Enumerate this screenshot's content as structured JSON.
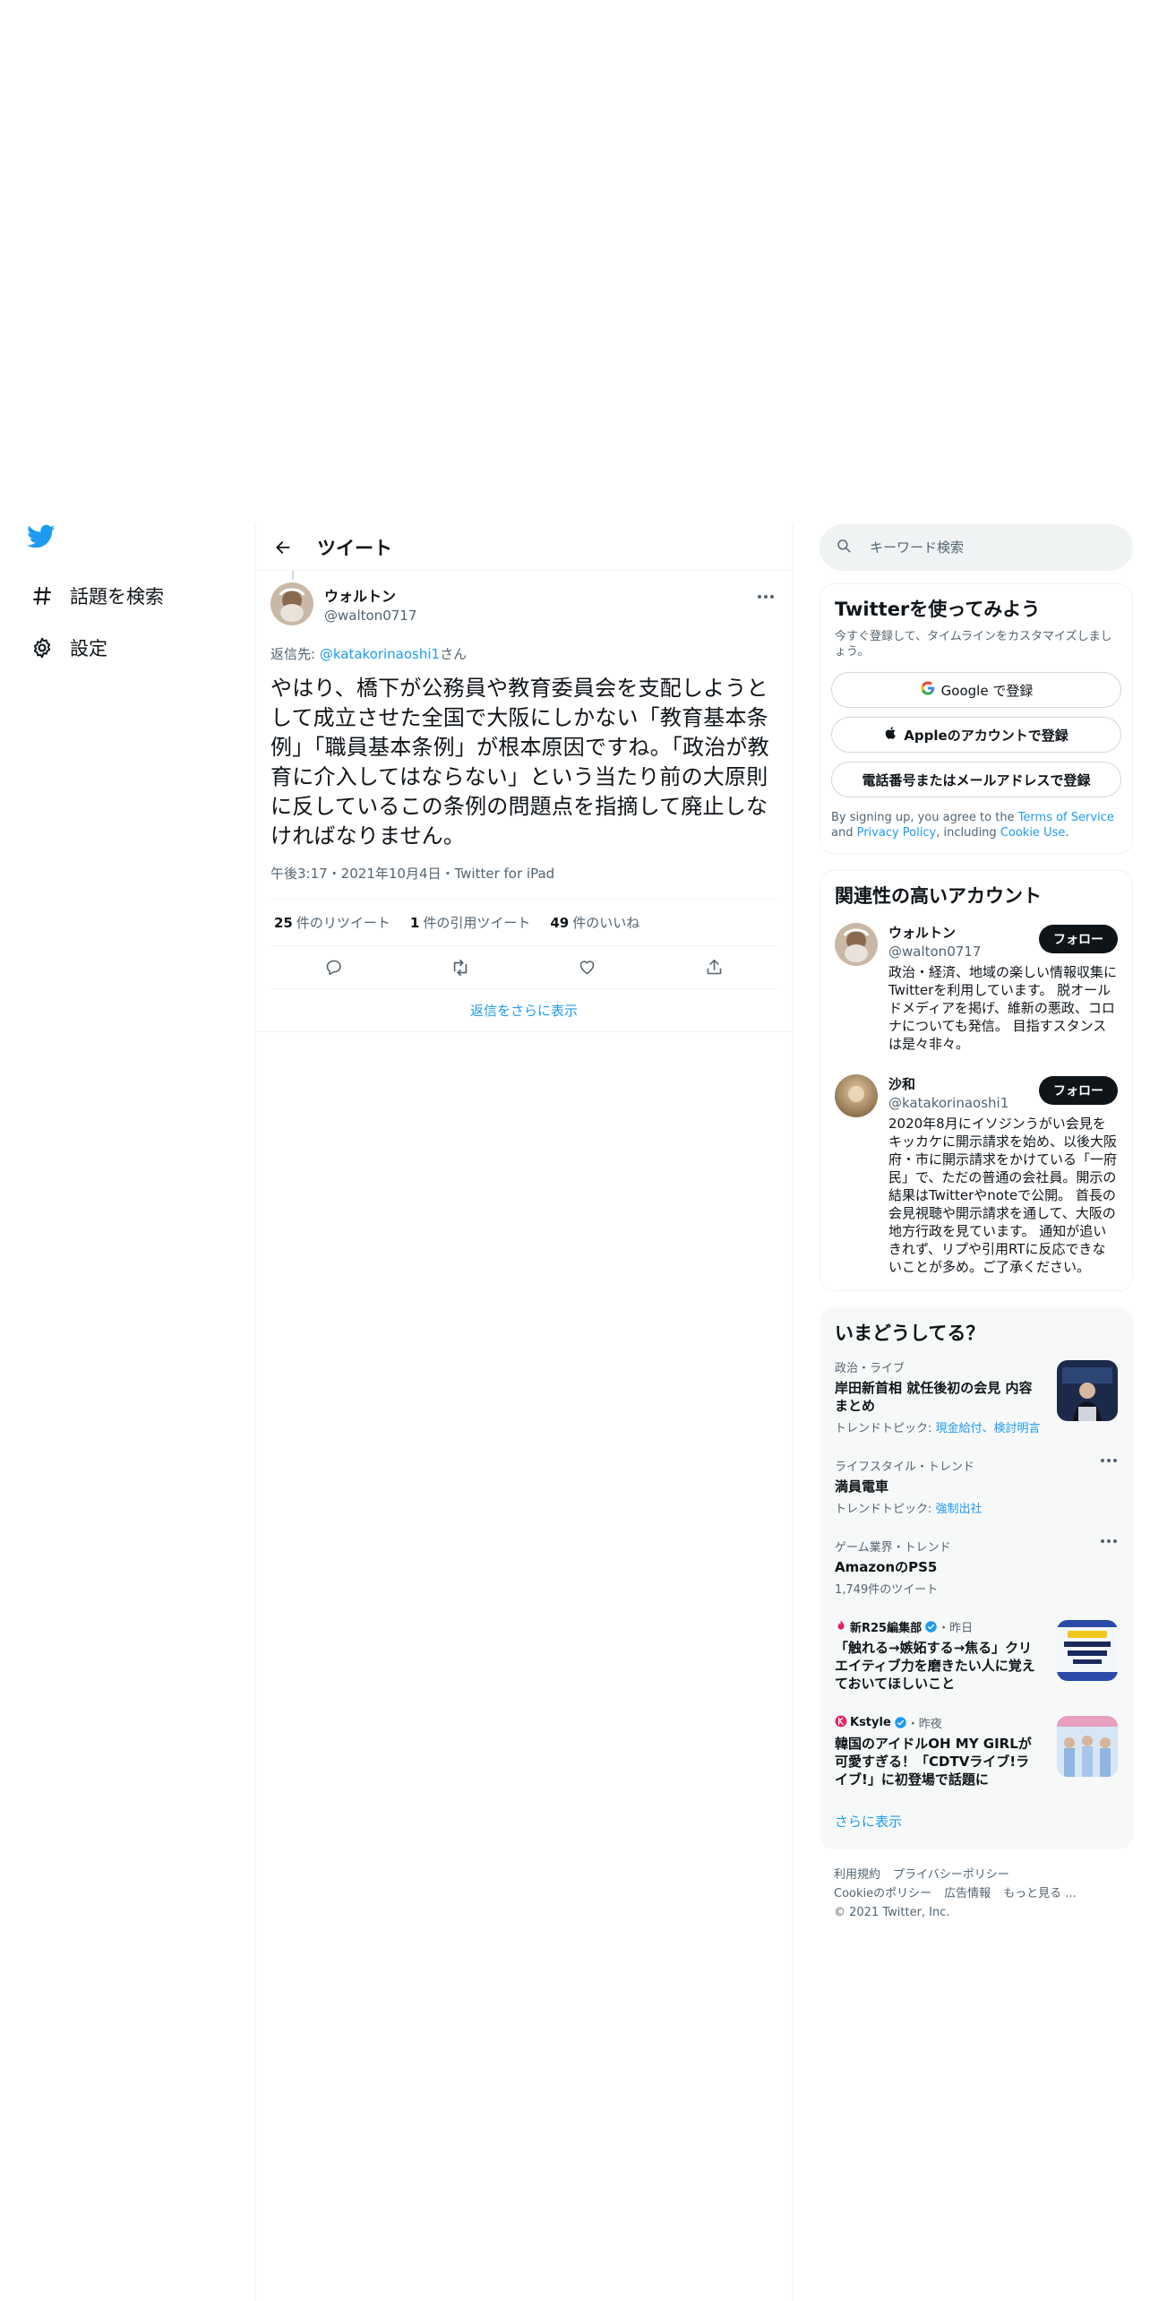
{
  "nav": {
    "items": [
      {
        "label": "話題を検索",
        "icon": "hashtag-icon"
      },
      {
        "label": "設定",
        "icon": "gear-icon"
      }
    ]
  },
  "header": {
    "title": "ツイート"
  },
  "tweet": {
    "author_name": "ウォルトン",
    "author_handle": "@walton0717",
    "reply_prefix": "返信先: ",
    "reply_handle": "@katakorinaoshi1",
    "reply_suffix": "さん",
    "text": "やはり、橋下が公務員や教育委員会を支配しようとして成立させた全国で大阪にしかない「教育基本条例」「職員基本条例」が根本原因ですね。「政治が教育に介入してはならない」という当たり前の大原則に反しているこの条例の問題点を指摘して廃止しなければなりません。",
    "meta": "午後3:17・2021年10月4日・Twitter for iPad",
    "retweets_count": "25",
    "retweets_label": "件のリツイート",
    "quotes_count": "1",
    "quotes_label": "件の引用ツイート",
    "likes_count": "49",
    "likes_label": "件のいいね",
    "show_more_replies": "返信をさらに表示"
  },
  "search": {
    "placeholder": "キーワード検索"
  },
  "signup": {
    "title": "Twitterを使ってみよう",
    "description": "今すぐ登録して、タイムラインをカスタマイズしましょう。",
    "google_label": "Google で登録",
    "apple_label": "Appleのアカウントで登録",
    "phone_label": "電話番号またはメールアドレスで登録",
    "terms_prefix": "By signing up, you agree to the ",
    "terms_link": "Terms of Service",
    "terms_and": " and ",
    "privacy_link": "Privacy Policy",
    "terms_including": ", including ",
    "cookie_link": "Cookie Use",
    "terms_end": "."
  },
  "related": {
    "title": "関連性の高いアカウント",
    "follow_label": "フォロー",
    "accounts": [
      {
        "name": "ウォルトン",
        "handle": "@walton0717",
        "bio": "政治・経済、地域の楽しい情報収集にTwitterを利用しています。 脱オールドメディアを掲げ、維新の悪政、コロナについても発信。 目指すスタンスは是々非々。"
      },
      {
        "name": "沙和",
        "handle": "@katakorinaoshi1",
        "bio": "2020年8月にイソジンうがい会見をキッカケに開示請求を始め、以後大阪府・市に開示請求をかけている「一府民」で、ただの普通の会社員。開示の結果はTwitterやnoteで公開。 首長の会見視聴や開示請求を通して、大阪の地方行政を見ています。 通知が追いきれず、リプや引用RTに反応できないことが多め。ご了承ください。"
      }
    ]
  },
  "trends": {
    "title": "いまどうしてる？",
    "show_more": "さらに表示",
    "items": [
      {
        "context": "政治・ライブ",
        "title": "岸田新首相 就任後初の会見 内容まとめ",
        "sub_prefix": "トレンドトピック: ",
        "sub_links": "現金給付、検討明言"
      },
      {
        "context": "ライフスタイル・トレンド",
        "title": "満員電車",
        "sub_prefix": "トレンドトピック: ",
        "sub_links": "強制出社"
      },
      {
        "context": "ゲーム業界・トレンド",
        "title": "AmazonのPS5",
        "sub": "1,749件のツイート"
      }
    ],
    "news": [
      {
        "source": "新R25編集部",
        "time": "・昨日",
        "title": "「触れる→嫉妬する→焦る」クリエイティブ力を磨きたい人に覚えておいてほしいこと"
      },
      {
        "source": "Kstyle",
        "time": "・昨夜",
        "title": "韓国のアイドルOH MY GIRLが可愛すぎる！「CDTVライブ!ライブ!」に初登場で話題に"
      }
    ]
  },
  "footer": {
    "terms": "利用規約",
    "privacy": "プライバシーポリシー",
    "cookie": "Cookieのポリシー",
    "ads": "広告情報",
    "more": "もっと見る ...",
    "copyright": "© 2021 Twitter, Inc."
  },
  "colors": {
    "accent": "#1d9bf0",
    "text": "#0f1419",
    "muted": "#536471",
    "border": "#eff3f4"
  }
}
